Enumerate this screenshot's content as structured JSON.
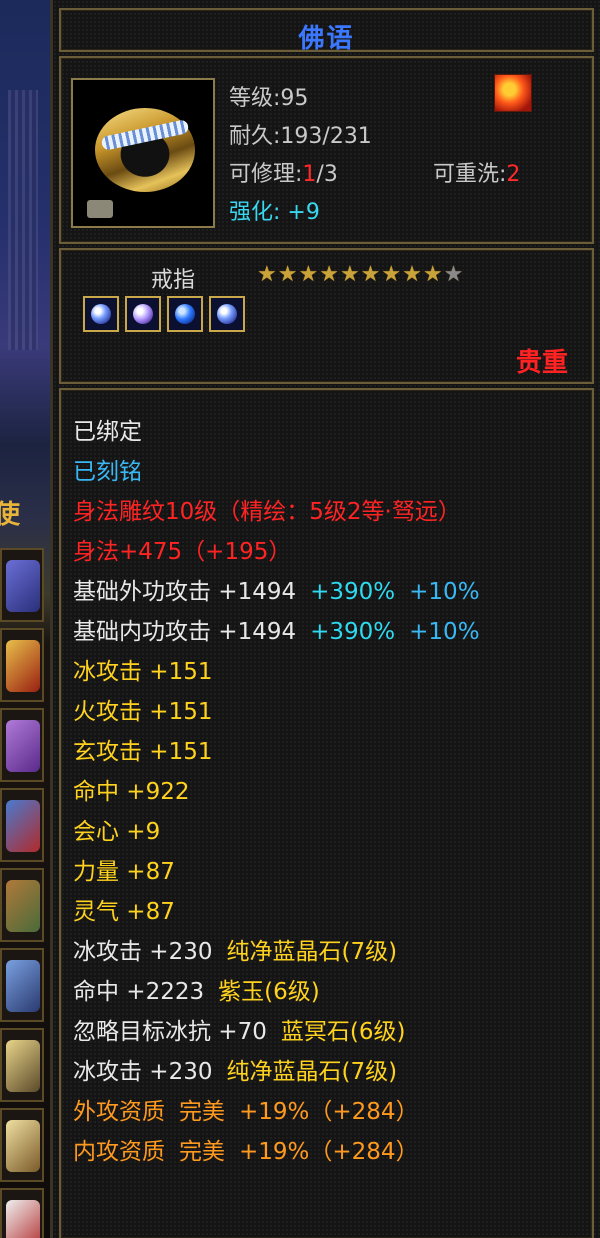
{
  "tooltip": {
    "title": "佛语",
    "header": {
      "level": "等级:95",
      "durability": "耐久:193/231",
      "repairable_label": "可修理:",
      "repairable_value": "1",
      "repairable_max": "/3",
      "rewash_label": "可重洗:",
      "rewash_value": "2",
      "enhance": "强化: +9"
    },
    "item_type": "戒指",
    "stars": {
      "filled": 9,
      "total": 10
    },
    "rarity": "贵重",
    "attributes": [
      {
        "text": "已绑定",
        "color": "white"
      },
      {
        "text": "已刻铭",
        "color": "cyan"
      },
      {
        "text": "身法雕纹10级（精绘：5级2等·驽远）",
        "color": "red"
      },
      {
        "text": "身法+475（+195）",
        "color": "red"
      },
      {
        "parts": [
          "基础外功攻击 +1494",
          "+390%",
          "+10%"
        ],
        "colors": [
          "white",
          "aqua",
          "cyan"
        ]
      },
      {
        "parts": [
          "基础内功攻击 +1494",
          "+390%",
          "+10%"
        ],
        "colors": [
          "white",
          "aqua",
          "cyan"
        ]
      },
      {
        "text": "冰攻击 +151",
        "color": "yellow"
      },
      {
        "text": "火攻击 +151",
        "color": "yellow"
      },
      {
        "text": "玄攻击 +151",
        "color": "yellow"
      },
      {
        "text": "命中 +922",
        "color": "yellow"
      },
      {
        "text": "会心 +9",
        "color": "yellow"
      },
      {
        "text": "力量 +87",
        "color": "yellow"
      },
      {
        "text": "灵气 +87",
        "color": "yellow"
      },
      {
        "parts": [
          "冰攻击 +230",
          "纯净蓝晶石(7级)"
        ],
        "colors": [
          "white",
          "yellow"
        ]
      },
      {
        "parts": [
          "命中 +2223",
          "紫玉(6级)"
        ],
        "colors": [
          "white",
          "yellow"
        ]
      },
      {
        "parts": [
          "忽略目标冰抗 +70",
          "蓝冥石(6级)"
        ],
        "colors": [
          "white",
          "yellow"
        ]
      },
      {
        "parts": [
          "冰攻击 +230",
          "纯净蓝晶石(7级)"
        ],
        "colors": [
          "white",
          "yellow"
        ]
      },
      {
        "parts": [
          "外攻资质",
          "完美",
          "+19%（+284）"
        ],
        "colors": [
          "orange",
          "orange",
          "orange"
        ]
      },
      {
        "parts": [
          "内攻资质",
          "完美",
          "+19%（+284）"
        ],
        "colors": [
          "orange",
          "orange",
          "orange"
        ]
      }
    ]
  },
  "icons": {
    "item": "gold-ring-icon",
    "emblem": "fire-emblem-icon",
    "gems": [
      "diamond-gem-icon",
      "purple-gem-icon",
      "blue-gem-icon",
      "diamond-gem-icon"
    ]
  }
}
